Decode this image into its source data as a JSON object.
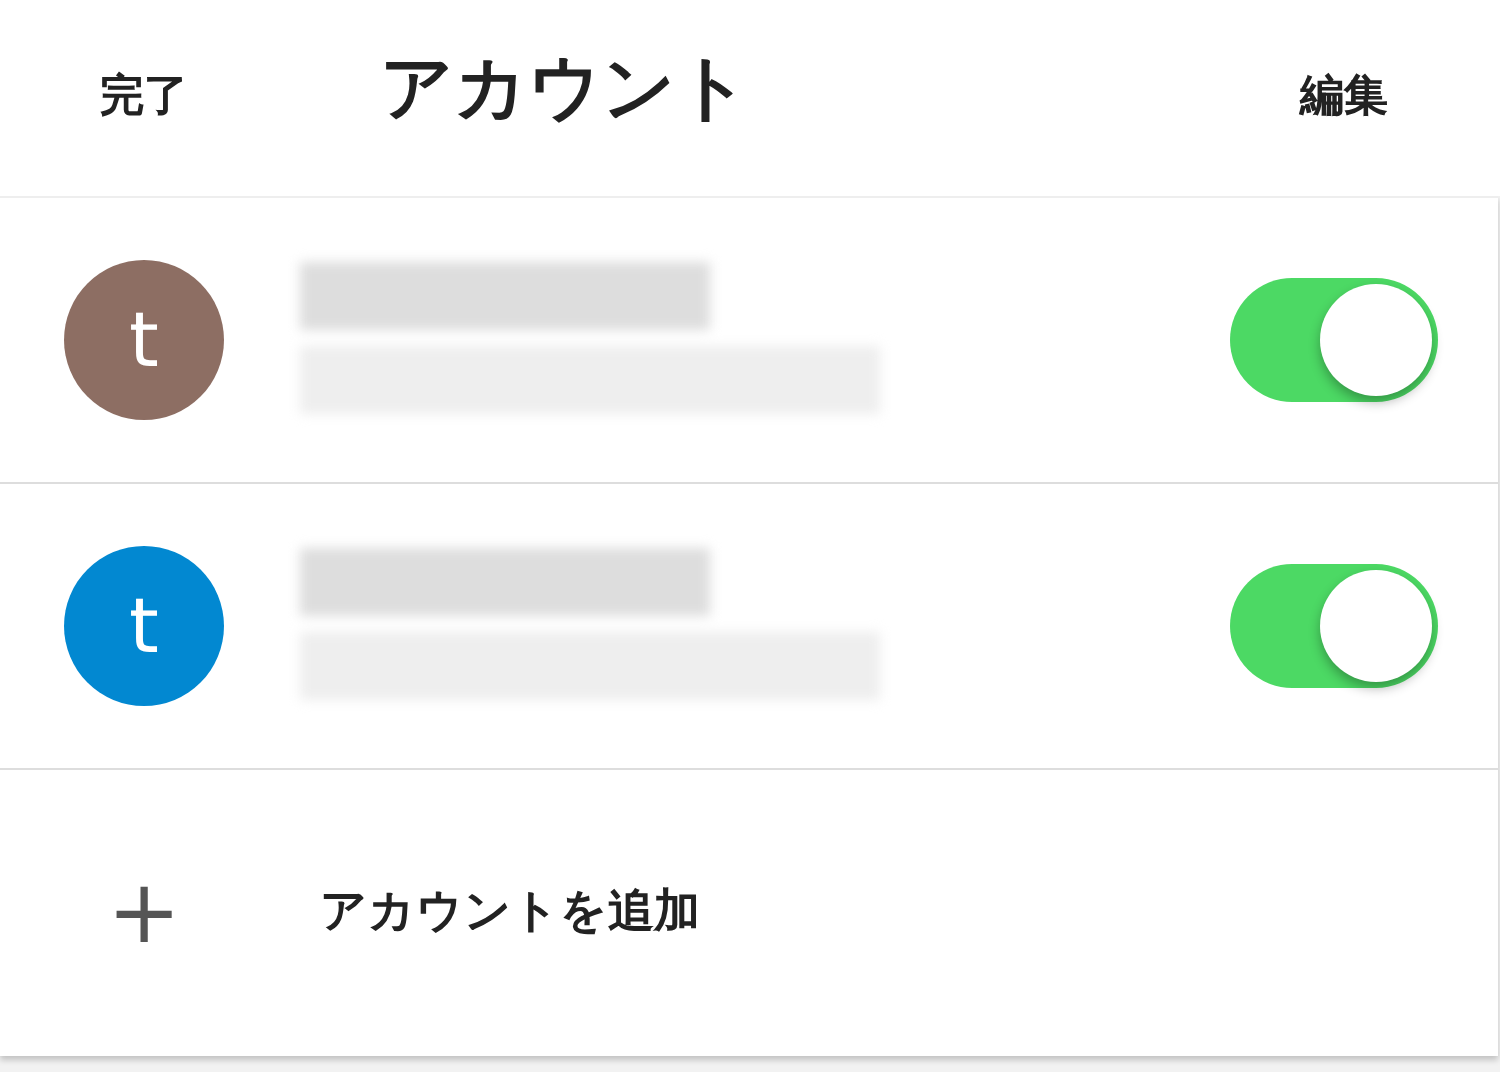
{
  "header": {
    "done": "完了",
    "title": "アカウント",
    "edit": "編集"
  },
  "accounts": [
    {
      "initial": "t",
      "color": "#8d6e63",
      "on": true
    },
    {
      "initial": "t",
      "color": "#0288d1",
      "on": true
    }
  ],
  "add_account": {
    "icon": "+",
    "label": "アカウントを追加"
  }
}
